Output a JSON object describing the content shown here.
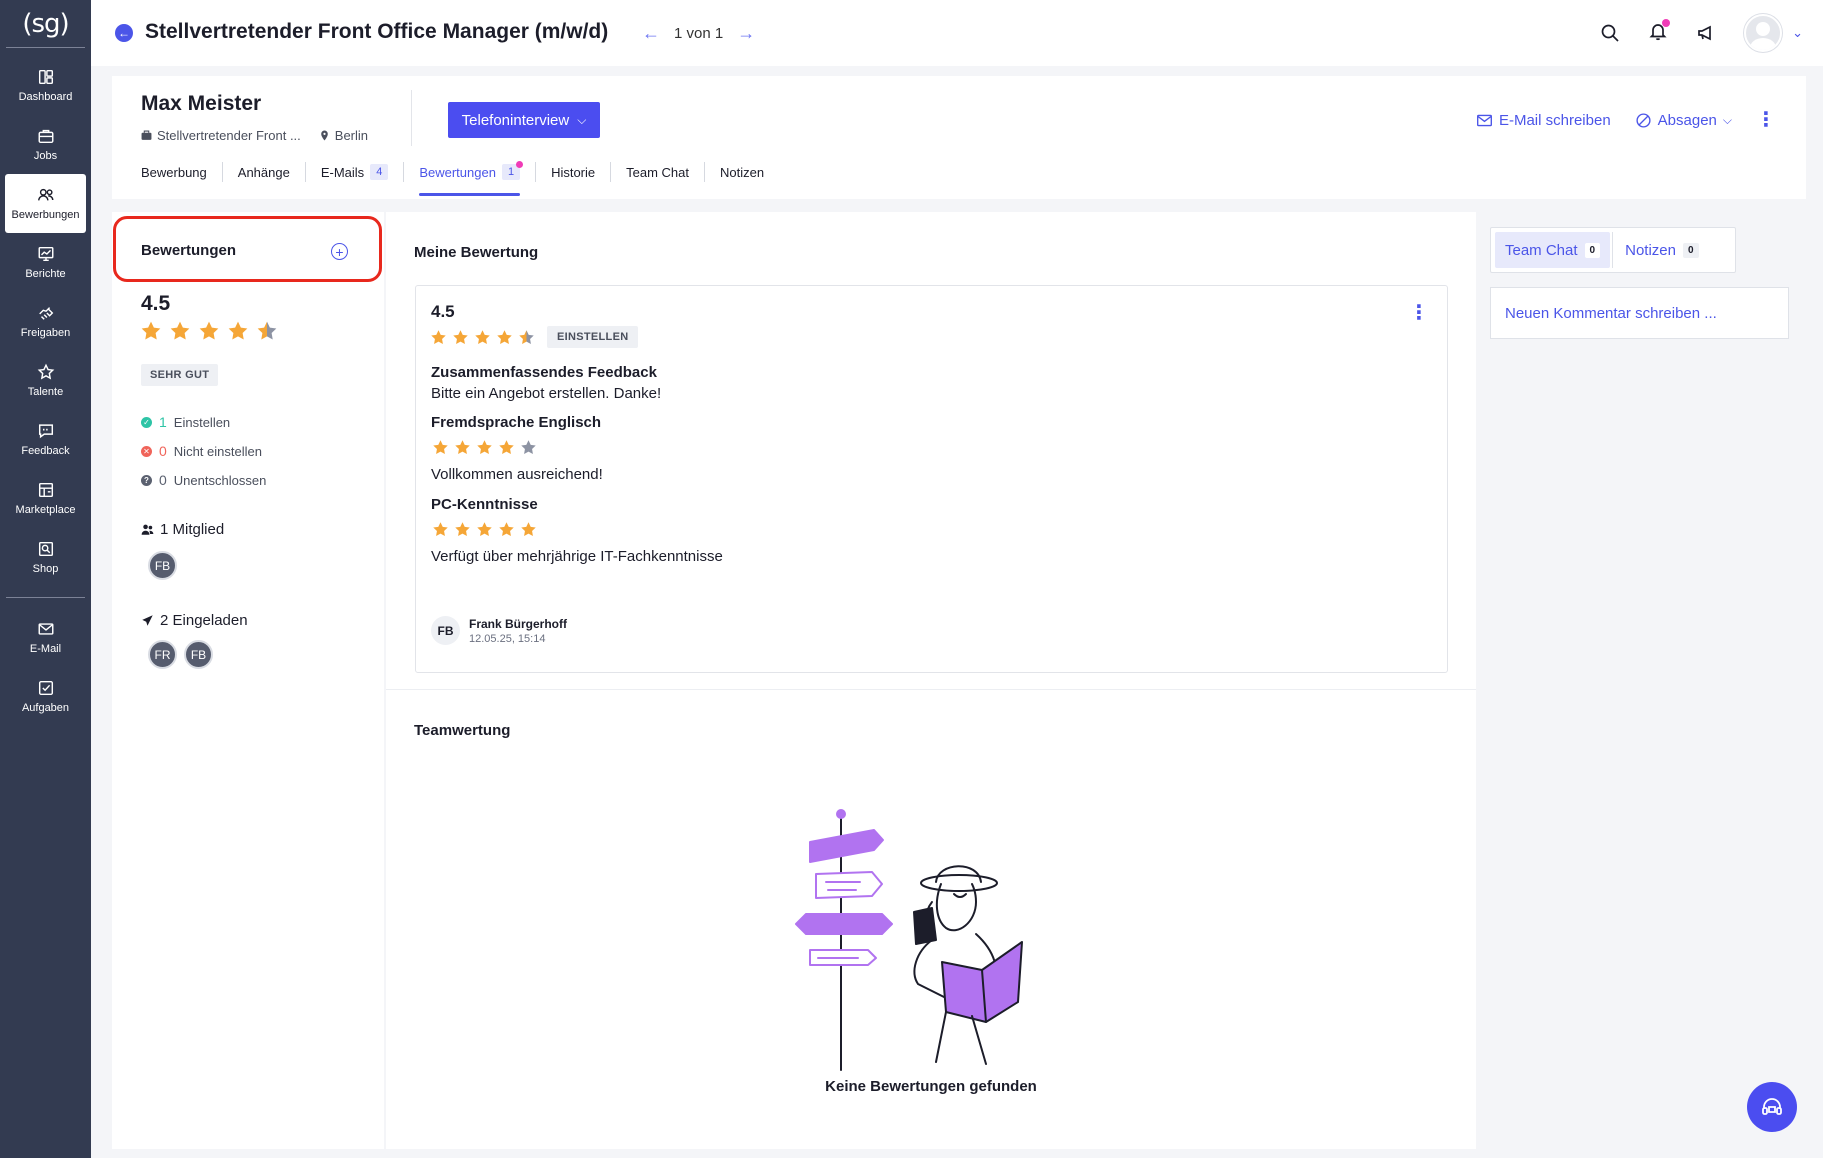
{
  "sidebar": {
    "logo": "(sg)",
    "items": [
      {
        "label": "Dashboard",
        "icon": "dashboard-icon"
      },
      {
        "label": "Jobs",
        "icon": "briefcase-icon"
      },
      {
        "label": "Bewerbungen",
        "icon": "users-icon",
        "active": true
      },
      {
        "label": "Berichte",
        "icon": "report-icon"
      },
      {
        "label": "Freigaben",
        "icon": "handshake-icon"
      },
      {
        "label": "Talente",
        "icon": "star-icon"
      },
      {
        "label": "Feedback",
        "icon": "feedback-icon"
      },
      {
        "label": "Marketplace",
        "icon": "store-icon"
      },
      {
        "label": "Shop",
        "icon": "shop-icon"
      }
    ],
    "bottom_items": [
      {
        "label": "E-Mail",
        "icon": "mail-icon"
      },
      {
        "label": "Aufgaben",
        "icon": "tasks-icon"
      }
    ]
  },
  "header": {
    "title": "Stellvertretender Front Office Manager (m/w/d)",
    "pager": "1 von 1"
  },
  "candidate": {
    "name": "Max Meister",
    "job": "Stellvertretender Front ...",
    "location": "Berlin",
    "stage": "Telefoninterview",
    "email_action": "E-Mail schreiben",
    "reject_action": "Absagen"
  },
  "tabs": [
    {
      "label": "Bewerbung"
    },
    {
      "label": "Anhänge"
    },
    {
      "label": "E-Mails",
      "badge": "4"
    },
    {
      "label": "Bewertungen",
      "badge": "1",
      "active": true
    },
    {
      "label": "Historie"
    },
    {
      "label": "Team Chat"
    },
    {
      "label": "Notizen"
    }
  ],
  "ratings_panel": {
    "title": "Bewertungen",
    "score": "4.5",
    "score_value": 4.5,
    "tag": "SEHR GUT",
    "votes": [
      {
        "count": "1",
        "label": "Einstellen",
        "color": "#2ec4a6"
      },
      {
        "count": "0",
        "label": "Nicht einstellen",
        "color": "#f0645a"
      },
      {
        "count": "0",
        "label": "Unentschlossen",
        "color": "#5b6170"
      }
    ],
    "members_label": "1 Mitglied",
    "members": [
      "FB"
    ],
    "invited_label": "2 Eingeladen",
    "invited": [
      "FR",
      "FB"
    ]
  },
  "my_rating": {
    "title": "Meine Bewertung",
    "score": "4.5",
    "score_value": 4.5,
    "tag": "EINSTELLEN",
    "summary_title": "Zusammenfassendes Feedback",
    "summary_text": "Bitte ein Angebot erstellen. Danke!",
    "criteria": [
      {
        "title": "Fremdsprache Englisch",
        "stars": 4,
        "text": "Vollkommen ausreichend!"
      },
      {
        "title": "PC-Kenntnisse",
        "stars": 5,
        "text": "Verfügt über mehrjährige IT-Fachkenntnisse"
      }
    ],
    "author_initials": "FB",
    "author_name": "Frank Bürgerhoff",
    "author_date": "12.05.25, 15:14"
  },
  "team_rating": {
    "title": "Teamwertung",
    "empty_text": "Keine Bewertungen gefunden"
  },
  "right_panel": {
    "tabs": [
      {
        "label": "Team Chat",
        "count": "0",
        "active": true
      },
      {
        "label": "Notizen",
        "count": "0"
      }
    ],
    "comment_placeholder": "Neuen Kommentar schreiben ..."
  },
  "colors": {
    "accent": "#4b4df0",
    "sidebar": "#333b51",
    "star": "#f5a637",
    "star_empty": "#8d93a3",
    "highlight": "#e8281d"
  }
}
